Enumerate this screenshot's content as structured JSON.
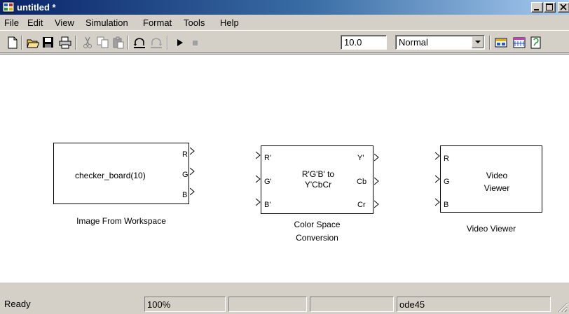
{
  "window": {
    "title": "untitled *"
  },
  "menu": [
    "File",
    "Edit",
    "View",
    "Simulation",
    "Format",
    "Tools",
    "Help"
  ],
  "toolbar": {
    "stop_time": "10.0",
    "sim_mode": "Normal"
  },
  "blocks": {
    "image_from_workspace": {
      "text": "checker_board(10)",
      "ports_out": [
        "R",
        "G",
        "B"
      ],
      "caption": "Image From Workspace"
    },
    "color_space": {
      "text_line1": "R'G'B' to",
      "text_line2": "Y'CbCr",
      "ports_in": [
        "R'",
        "G'",
        "B'"
      ],
      "ports_out": [
        "Y'",
        "Cb",
        "Cr"
      ],
      "caption_line1": "Color Space",
      "caption_line2": "Conversion"
    },
    "video_viewer": {
      "text_line1": "Video",
      "text_line2": "Viewer",
      "ports_in": [
        "R",
        "G",
        "B"
      ],
      "caption": "Video Viewer"
    }
  },
  "status": {
    "state": "Ready",
    "zoom": "100%",
    "solver": "ode45"
  }
}
